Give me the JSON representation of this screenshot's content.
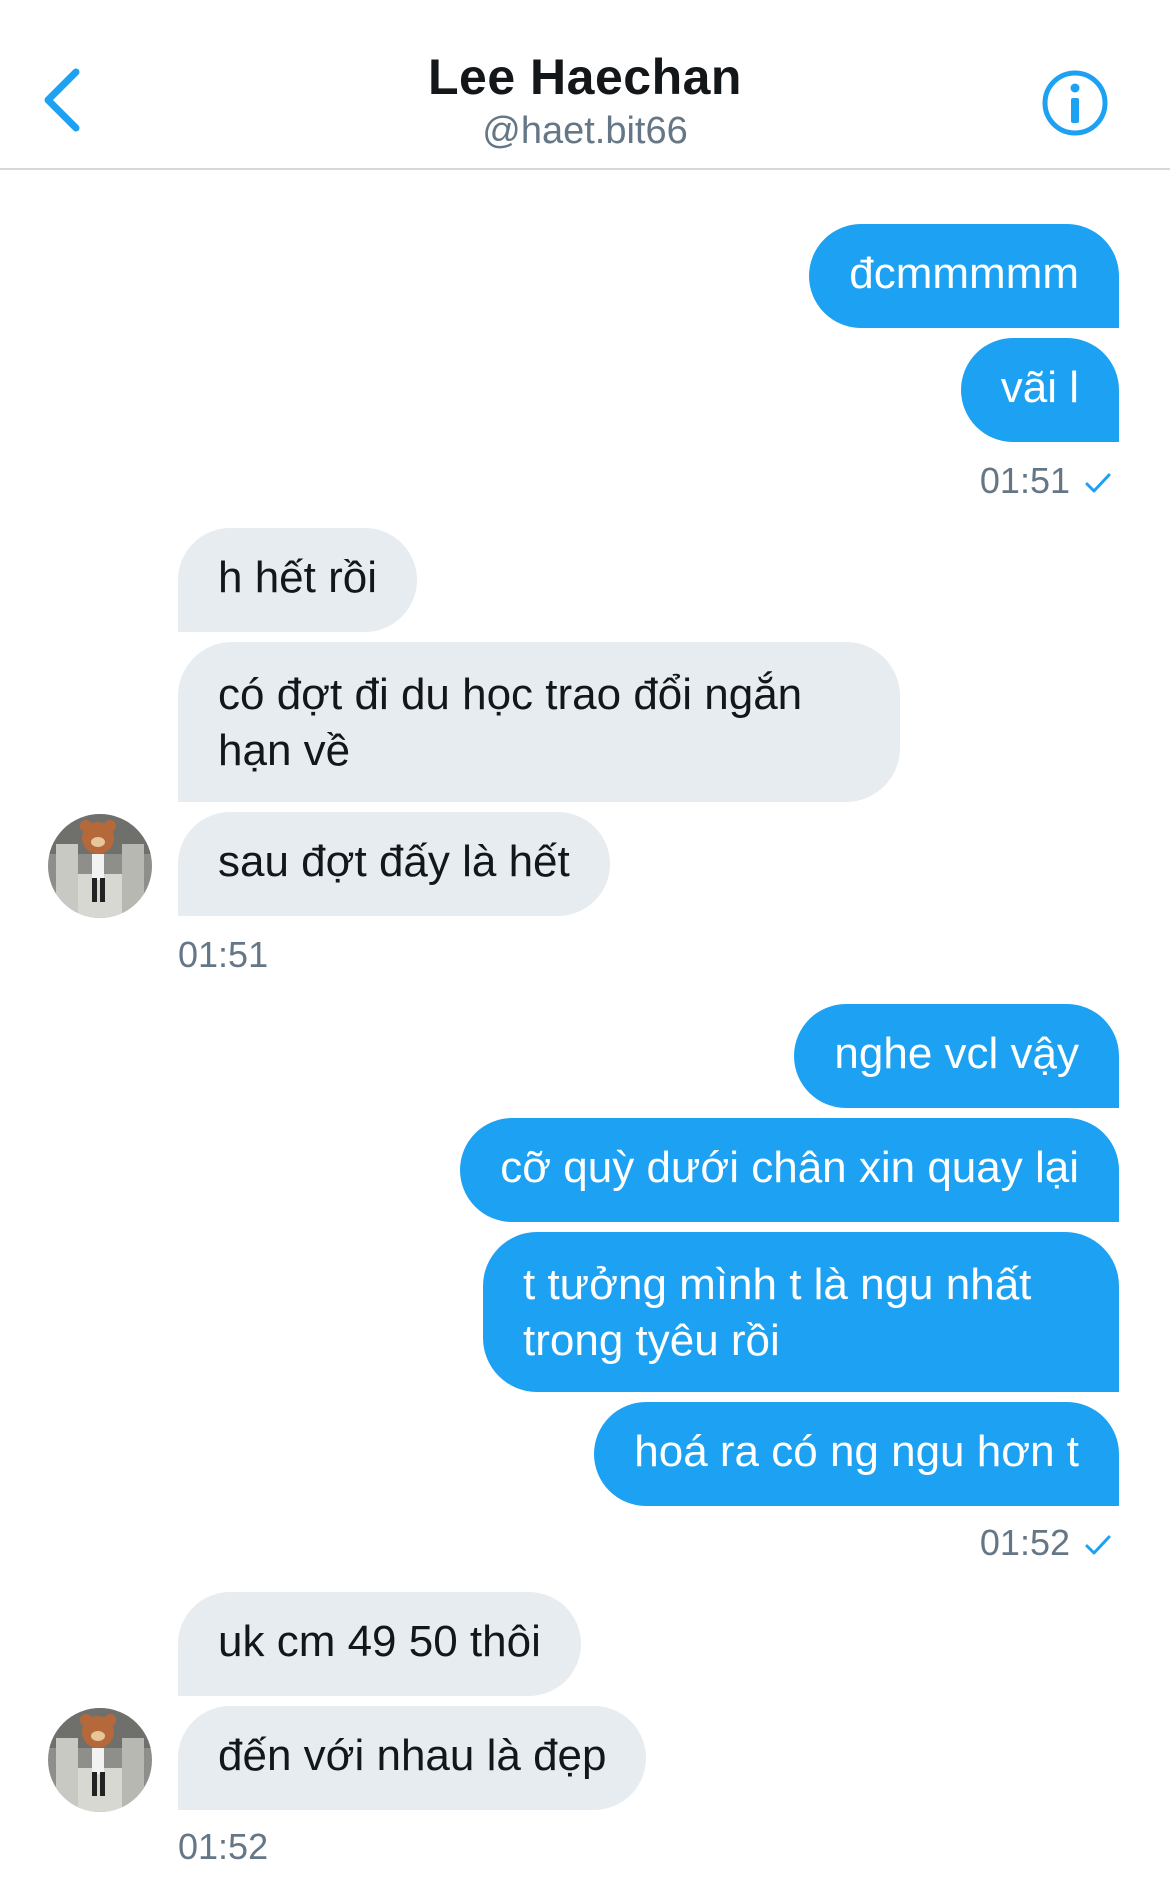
{
  "header": {
    "title": "Lee Haechan",
    "handle": "@haet.bit66",
    "accent_color": "#1da1f2",
    "back_icon": "chevron-left-icon",
    "info_icon": "info-circle-icon"
  },
  "messages": [
    {
      "from": "me",
      "text": "đcmmmmm"
    },
    {
      "from": "me",
      "text": "vãi l"
    },
    {
      "from": "me",
      "time": "01:51",
      "status_icon": "check-icon"
    },
    {
      "from": "them",
      "text": "h hết rồi"
    },
    {
      "from": "them",
      "text": "có đợt đi du học trao đổi ngắn hạn về"
    },
    {
      "from": "them",
      "text": "sau đợt đấy là hết"
    },
    {
      "from": "them",
      "time": "01:51"
    },
    {
      "from": "me",
      "text": "nghe vcl vậy"
    },
    {
      "from": "me",
      "text": "cỡ quỳ dưới chân xin quay lại"
    },
    {
      "from": "me",
      "text": "t tưởng mình t là ngu nhất trong tyêu rồi"
    },
    {
      "from": "me",
      "text": "hoá ra có ng ngu hơn t"
    },
    {
      "from": "me",
      "time": "01:52",
      "status_icon": "check-icon"
    },
    {
      "from": "them",
      "text": "uk cm 49 50 thôi"
    },
    {
      "from": "them",
      "text": "đến với nhau là đẹp"
    },
    {
      "from": "them",
      "time": "01:52"
    }
  ],
  "colors": {
    "sent_bubble": "#1da1f2",
    "received_bubble": "#e6ecf0",
    "timestamp": "#657786"
  }
}
